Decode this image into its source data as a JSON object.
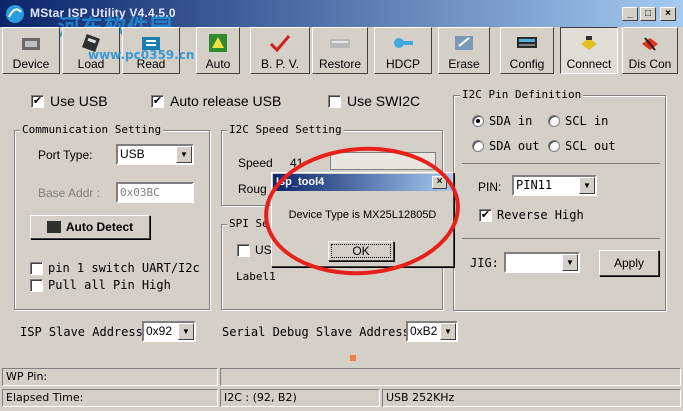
{
  "window": {
    "title": "MStar ISP Utility V4.4.5.0",
    "minimize_glyph": "_",
    "maximize_glyph": "□",
    "close_glyph": "×"
  },
  "watermark": {
    "text": "河东软件园",
    "url": "www.pc0359.cn"
  },
  "toolbar": {
    "buttons": [
      {
        "label": "Device",
        "icon": "device-icon"
      },
      {
        "label": "Load",
        "icon": "load-icon"
      },
      {
        "label": "Read",
        "icon": "read-icon"
      },
      {
        "label": "Auto",
        "icon": "auto-icon"
      },
      {
        "label": "B. P. V.",
        "icon": "bpv-icon"
      },
      {
        "label": "Restore",
        "icon": "restore-icon"
      },
      {
        "label": "HDCP",
        "icon": "hdcp-icon"
      },
      {
        "label": "Erase",
        "icon": "erase-icon"
      },
      {
        "label": "Config",
        "icon": "config-icon"
      },
      {
        "label": "Connect",
        "icon": "connect-icon"
      },
      {
        "label": "Dis Con",
        "icon": "disconnect-icon"
      }
    ]
  },
  "options": {
    "use_usb": "Use USB",
    "auto_release_usb": "Auto release USB",
    "use_swi2c": "Use SWI2C",
    "check_mark": "✔"
  },
  "comm": {
    "title": "Communication Setting",
    "port_type_label": "Port Type:",
    "port_type_value": "USB",
    "base_addr_label": "Base Addr :",
    "base_addr_value": "0x03BC",
    "auto_detect": "Auto Detect",
    "pin1_switch": "pin 1 switch UART/I2c",
    "pull_all": "Pull all Pin High"
  },
  "speed": {
    "title": "I2C Speed Setting",
    "speed_label": "Speed",
    "speed_value": "41",
    "rough_label": "Roug"
  },
  "spi": {
    "title": "SPI Se",
    "us_label": "US",
    "label_text": "Label1"
  },
  "i2c_pin": {
    "title": "I2C Pin Definition",
    "sda_in": "SDA in",
    "scl_in": "SCL in",
    "sda_out": "SDA out",
    "scl_out": "SCL out",
    "pin_label": "PIN:",
    "pin_value": "PIN11",
    "reverse_high": "Reverse High",
    "jig_label": "JIG:",
    "jig_value": "",
    "apply": "Apply"
  },
  "bottom": {
    "isp_slave_label": "ISP Slave Address:",
    "isp_slave_value": "0x92",
    "serial_debug_label": "Serial Debug Slave Address:",
    "serial_debug_value": "0xB2"
  },
  "dialog": {
    "title": "Isp_tool4",
    "message": "Device Type is MX25L12805D",
    "ok": "OK",
    "close_glyph": "×"
  },
  "status": {
    "wp_pin": "WP Pin:",
    "elapsed": "Elapsed Time:",
    "i2c": "I2C : (92, B2)",
    "usb": "USB  252KHz"
  }
}
